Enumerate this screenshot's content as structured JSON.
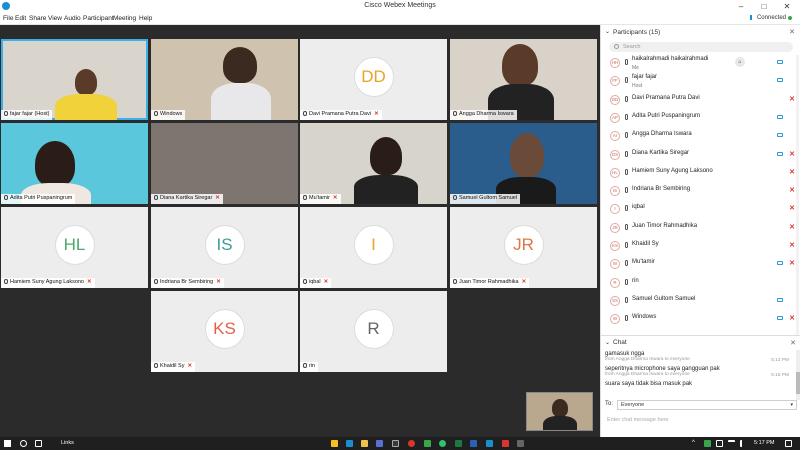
{
  "window": {
    "title": "Cisco Webex Meetings"
  },
  "menu": {
    "items": [
      "File",
      "Edit",
      "Share",
      "View",
      "Audio",
      "Participant",
      "Meeting",
      "Help"
    ],
    "status": "Connected"
  },
  "tiles": [
    {
      "name": "fajar fajar",
      "suffix": "(Host)",
      "kind": "video",
      "muted": false
    },
    {
      "name": "Windows",
      "kind": "video",
      "muted": false
    },
    {
      "name": "Davi Pramana Putra Davi",
      "initials": "DD",
      "initials_color": "#e8a428",
      "kind": "initials",
      "muted": true
    },
    {
      "name": "Angga Dharma Iswara",
      "kind": "video",
      "muted": false
    },
    {
      "name": "Adita Putri Puspaningrum",
      "kind": "video",
      "muted": false
    },
    {
      "name": "Diana Kartika Siregar",
      "kind": "video",
      "muted": true
    },
    {
      "name": "Mu'tamir",
      "kind": "video",
      "muted": true
    },
    {
      "name": "Samuel Gultom Samuel",
      "kind": "video",
      "muted": false
    },
    {
      "name": "Hamiem Suny Agung Laksono",
      "initials": "HL",
      "initials_color": "#4aa86b",
      "kind": "initials",
      "muted": true
    },
    {
      "name": "Indriana Br Sembiring",
      "initials": "IS",
      "initials_color": "#3a9e94",
      "kind": "initials",
      "muted": true
    },
    {
      "name": "iqbal",
      "initials": "I",
      "initials_color": "#e8a428",
      "kind": "initials",
      "muted": true
    },
    {
      "name": "Juan Timor Rahmadhika",
      "initials": "JR",
      "initials_color": "#e0754a",
      "kind": "initials",
      "muted": true
    },
    {
      "name": "Khaidil Sy",
      "initials": "KS",
      "initials_color": "#e0604a",
      "kind": "initials",
      "muted": true
    },
    {
      "name": "rin",
      "initials": "R",
      "initials_color": "#666666",
      "kind": "initials",
      "muted": false
    }
  ],
  "participants": {
    "header": "Participants (15)",
    "search_placeholder": "Search",
    "list": [
      {
        "initials": "HH",
        "name": "haikalrahmadi haikalrahmadi",
        "role": "Me",
        "video": true,
        "muted": false
      },
      {
        "initials": "FF",
        "name": "fajar fajar",
        "role": "Host",
        "video": true,
        "muted": false
      },
      {
        "initials": "DD",
        "name": "Davi Pramana Putra Davi",
        "role": "",
        "video": false,
        "muted": true
      },
      {
        "initials": "AP",
        "name": "Adita Putri Puspaningrum",
        "role": "",
        "video": true,
        "muted": false
      },
      {
        "initials": "AI",
        "name": "Angga Dharma Iswara",
        "role": "",
        "video": true,
        "muted": false
      },
      {
        "initials": "DS",
        "name": "Diana Kartika Siregar",
        "role": "",
        "video": true,
        "muted": true
      },
      {
        "initials": "HL",
        "name": "Hamiem Suny Agung Laksono",
        "role": "",
        "video": false,
        "muted": true
      },
      {
        "initials": "IS",
        "name": "Indriana Br Sembiring",
        "role": "",
        "video": false,
        "muted": true
      },
      {
        "initials": "I",
        "name": "iqbal",
        "role": "",
        "video": false,
        "muted": true
      },
      {
        "initials": "JR",
        "name": "Juan Timor Rahmadhika",
        "role": "",
        "video": false,
        "muted": true
      },
      {
        "initials": "KS",
        "name": "Khaidil Sy",
        "role": "",
        "video": false,
        "muted": true
      },
      {
        "initials": "M",
        "name": "Mu'tamir",
        "role": "",
        "video": true,
        "muted": true
      },
      {
        "initials": "R",
        "name": "rin",
        "role": "",
        "video": false,
        "muted": false
      },
      {
        "initials": "SS",
        "name": "Samuel Gultom Samuel",
        "role": "",
        "video": true,
        "muted": false
      },
      {
        "initials": "W",
        "name": "Windows",
        "role": "",
        "video": true,
        "muted": true
      }
    ]
  },
  "chat": {
    "header": "Chat",
    "messages": [
      {
        "text": "gamasuk ngga",
        "meta": "from Angga Dharma Iswara to everyone",
        "time": "5:13 PM"
      },
      {
        "text": "seperitnya microphone saya gangguan pak",
        "meta": "from Angga Dharma Iswara to everyone",
        "time": "5:15 PM"
      },
      {
        "text": "suara saya tidak bisa masuk pak",
        "meta": "",
        "time": ""
      }
    ],
    "to_label": "To:",
    "to_value": "Everyone",
    "input_placeholder": "Enter chat message here"
  },
  "taskbar": {
    "links_label": "Links",
    "time": "5:17 PM"
  },
  "colors": {
    "accent": "#1a8fd0",
    "muted": "#d9372e",
    "active_outline": "#3bb0e8"
  }
}
